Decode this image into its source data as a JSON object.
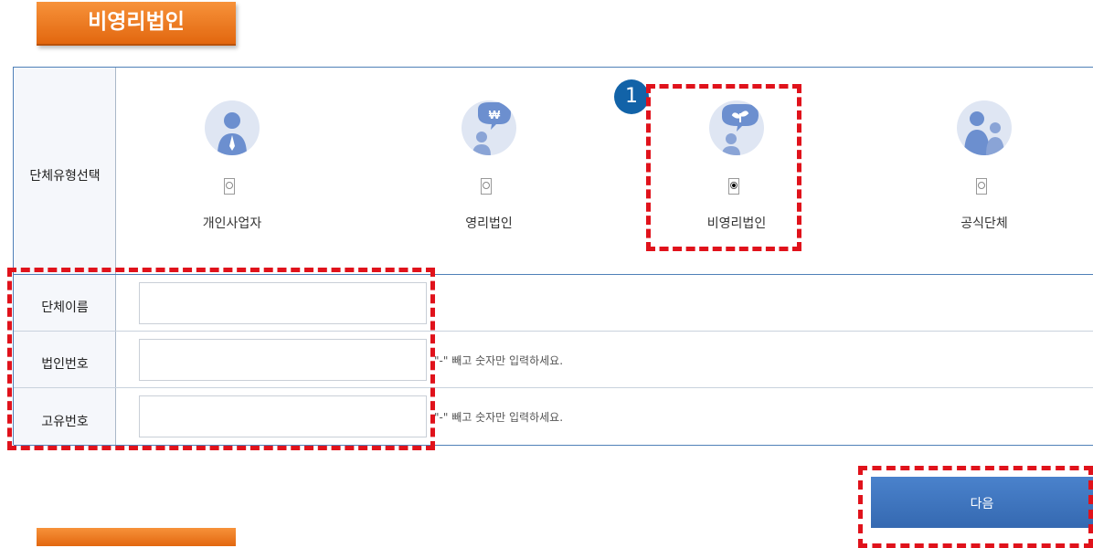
{
  "section_title": "비영리법인",
  "form": {
    "type_row_label": "단체유형선택",
    "types": [
      {
        "label": "개인사업자",
        "icon": "person-icon",
        "selected": false
      },
      {
        "label": "영리법인",
        "icon": "won-bubble-person-icon",
        "selected": false
      },
      {
        "label": "비영리법인",
        "icon": "plant-bubble-person-icon",
        "selected": true
      },
      {
        "label": "공식단체",
        "icon": "group-people-icon",
        "selected": false
      }
    ],
    "org_name_label": "단체이름",
    "corp_number_label": "법인번호",
    "corp_number_hint": "\"-\" 빼고 숫자만 입력하세요.",
    "unique_number_label": "고유번호",
    "unique_number_hint": "\"-\" 빼고 숫자만 입력하세요."
  },
  "next_button": "다음",
  "step_badge": "1",
  "colors": {
    "accent_orange": "#e8731a",
    "border_blue": "#4f80b8",
    "button_blue": "#3f78c3",
    "highlight_red": "#e0121b"
  }
}
